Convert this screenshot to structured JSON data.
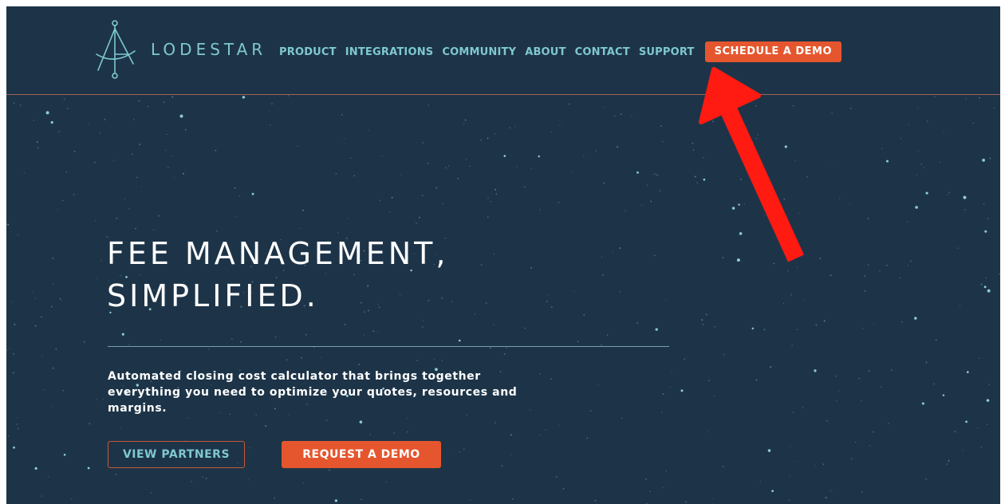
{
  "brand": {
    "name": "LODESTAR",
    "logo_icon": "compass-anchor-icon"
  },
  "nav": {
    "items": [
      {
        "label": "PRODUCT"
      },
      {
        "label": "INTEGRATIONS"
      },
      {
        "label": "COMMUNITY"
      },
      {
        "label": "ABOUT"
      },
      {
        "label": "CONTACT"
      },
      {
        "label": "SUPPORT"
      }
    ],
    "cta_label": "SCHEDULE A DEMO"
  },
  "hero": {
    "title_line1": "FEE MANAGEMENT,",
    "title_line2": "SIMPLIFIED.",
    "description": "Automated closing cost calculator that brings together everything you need to optimize your quotes, resources and margins.",
    "secondary_button": "VIEW PARTNERS",
    "primary_button": "REQUEST A DEMO"
  },
  "annotation": {
    "icon": "red-arrow-icon",
    "points_to": "SUPPORT"
  },
  "colors": {
    "background": "#1d3448",
    "accent": "#e6562e",
    "teal": "#7fc8cf",
    "arrow": "#ff1a12"
  }
}
